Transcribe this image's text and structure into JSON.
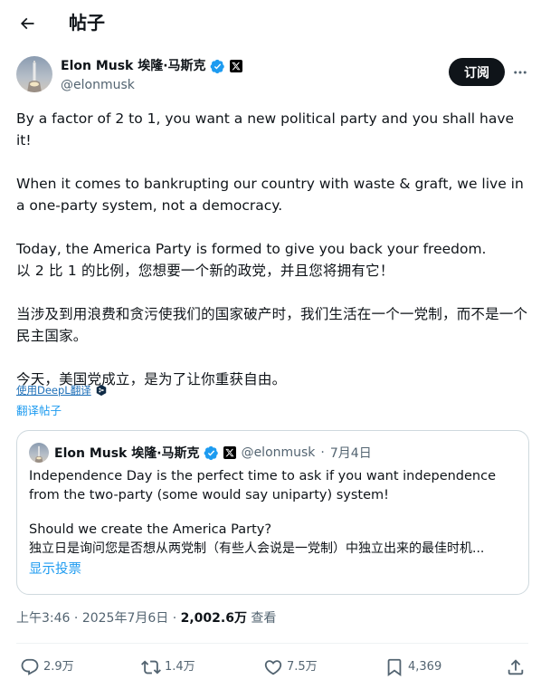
{
  "header": {
    "title": "帖子",
    "back_icon": "arrow-left-icon"
  },
  "author": {
    "name": "Elon Musk 埃隆·马斯克",
    "handle": "@elonmusk",
    "subscribe_label": "订阅",
    "more_icon": "ellipsis-icon",
    "verified_color": "#1d9bf0"
  },
  "tweet": {
    "p1": "By a factor of 2 to 1, you want a new political party and you shall have it!",
    "p2": "When it comes to bankrupting our country with waste & graft, we live in a one-party system, not a democracy.",
    "p3": "Today, the America Party is formed to give you back your freedom.",
    "p4": "以 2 比 1 的比例，您想要一个新的政党，并且您将拥有它！",
    "p5": "当涉及到用浪费和贪污使我们的国家破产时，我们生活在一个一党制，而不是一个民主国家。",
    "p6": "今天，美国党成立，是为了让你重获自由。"
  },
  "translation": {
    "deepl_label": "使用DeepL翻译",
    "translate_post_label": "翻译帖子"
  },
  "quote": {
    "name": "Elon Musk 埃隆·马斯克",
    "handle": "@elonmusk",
    "separator": "·",
    "date": "7月4日",
    "line1": "Independence Day is the perfect time to ask if you want independence from the two-party (some would say uniparty) system!",
    "line2": "Should we create the America Party?",
    "line3": "独立日是询问您是否想从两党制（有些人会说是一党制）中独立出来的最佳时机...",
    "show_poll": "显示投票"
  },
  "meta": {
    "time": "上午3:46",
    "sep1": " · ",
    "date": "2025年7月6日",
    "sep2": " · ",
    "views": "2,002.6万",
    "views_label": " 查看"
  },
  "actions": {
    "replies": "2.9万",
    "reposts": "1.4万",
    "likes": "7.5万",
    "bookmarks": "4,369"
  }
}
